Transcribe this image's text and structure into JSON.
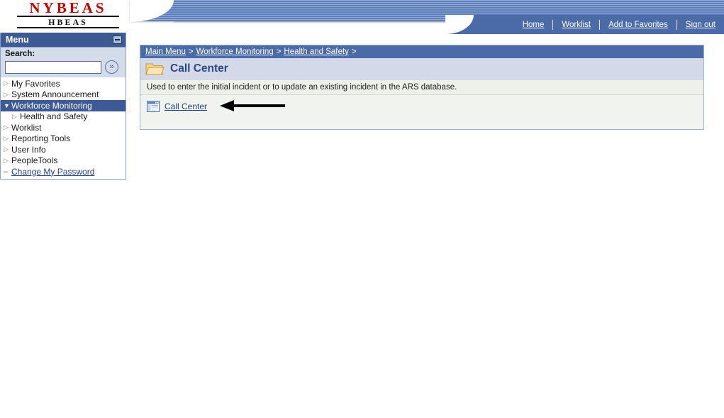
{
  "branding": {
    "logo_main": "NYBEAS",
    "logo_sub": "HBEAS"
  },
  "header": {
    "links": [
      {
        "label": "Home",
        "name": "home-link"
      },
      {
        "label": "Worklist",
        "name": "worklist-link"
      },
      {
        "label": "Add to Favorites",
        "name": "add-to-favorites-link"
      },
      {
        "label": "Sign out",
        "name": "sign-out-link"
      }
    ]
  },
  "sidebar": {
    "title": "Menu",
    "minimize_icon": "minimize-icon",
    "search": {
      "label": "Search:",
      "value": "",
      "placeholder": "",
      "go_icon": "»"
    },
    "items": [
      {
        "label": "My Favorites",
        "marker": "▷",
        "state": "collapsed"
      },
      {
        "label": "System Announcement",
        "marker": "▷",
        "state": "collapsed"
      },
      {
        "label": "Workforce Monitoring",
        "marker": "▼",
        "state": "expanded-selected"
      },
      {
        "label": "Health and Safety",
        "marker": "▷",
        "state": "child"
      },
      {
        "label": "Worklist",
        "marker": "▷",
        "state": "collapsed"
      },
      {
        "label": "Reporting Tools",
        "marker": "▷",
        "state": "collapsed"
      },
      {
        "label": "User Info",
        "marker": "▷",
        "state": "collapsed"
      },
      {
        "label": "PeopleTools",
        "marker": "▷",
        "state": "collapsed"
      },
      {
        "label": "Change My Password",
        "marker": "–",
        "state": "link"
      }
    ]
  },
  "content": {
    "breadcrumb": {
      "items": [
        "Main Menu",
        "Workforce Monitoring",
        "Health and Safety"
      ],
      "separator": ">",
      "trailing_separator": ">"
    },
    "page_title": "Call Center",
    "folder_icon": "open-folder-icon",
    "description": "Used to enter the initial incident or to update an existing incident in the ARS database.",
    "component_link": {
      "label": "Call Center",
      "icon": "component-page-icon"
    },
    "annotation": {
      "type": "left-arrow",
      "color": "#000000"
    }
  },
  "colors": {
    "banner_blue": "#5b7ebd",
    "nav_blue": "#4a6ba8",
    "menu_header_blue": "#3d5a94",
    "title_band": "#d3d9e8",
    "panel_bg": "#f1f3ee",
    "link_blue": "#23417d",
    "logo_red": "#cc0000"
  }
}
